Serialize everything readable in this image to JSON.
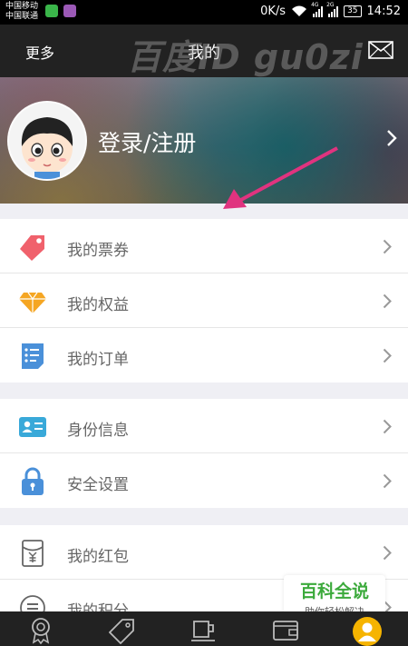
{
  "status_bar": {
    "carrier1": "中国移动",
    "carrier2": "中国联通",
    "speed": "0K/s",
    "net1": "4G",
    "net2": "2G",
    "battery": "35",
    "time": "14:52"
  },
  "header": {
    "left_label": "更多",
    "title": "我的",
    "watermark": "百度ID gu0zi"
  },
  "profile": {
    "login_label": "登录/注册"
  },
  "groups": [
    {
      "items": [
        {
          "label": "我的票券",
          "icon": "ticket-icon",
          "color": "#f0616c"
        },
        {
          "label": "我的权益",
          "icon": "diamond-icon",
          "color": "#f5a623"
        },
        {
          "label": "我的订单",
          "icon": "order-list-icon",
          "color": "#4a90d9"
        }
      ]
    },
    {
      "items": [
        {
          "label": "身份信息",
          "icon": "id-card-icon",
          "color": "#39a9d9"
        },
        {
          "label": "安全设置",
          "icon": "lock-icon",
          "color": "#4a90d9"
        }
      ]
    },
    {
      "items": [
        {
          "label": "我的红包",
          "icon": "red-envelope-icon",
          "color": "#666666"
        },
        {
          "label": "我的积分",
          "icon": "points-icon",
          "color": "#666666"
        }
      ]
    }
  ],
  "badge": {
    "title": "百科全说",
    "subtitle": "助你轻松解决"
  },
  "tabbar": {
    "tabs": [
      "award-icon",
      "tag-icon",
      "coffee-cup-icon",
      "wallet-icon",
      "user-icon"
    ],
    "active_index": 4,
    "active_color": "#f6b400"
  }
}
